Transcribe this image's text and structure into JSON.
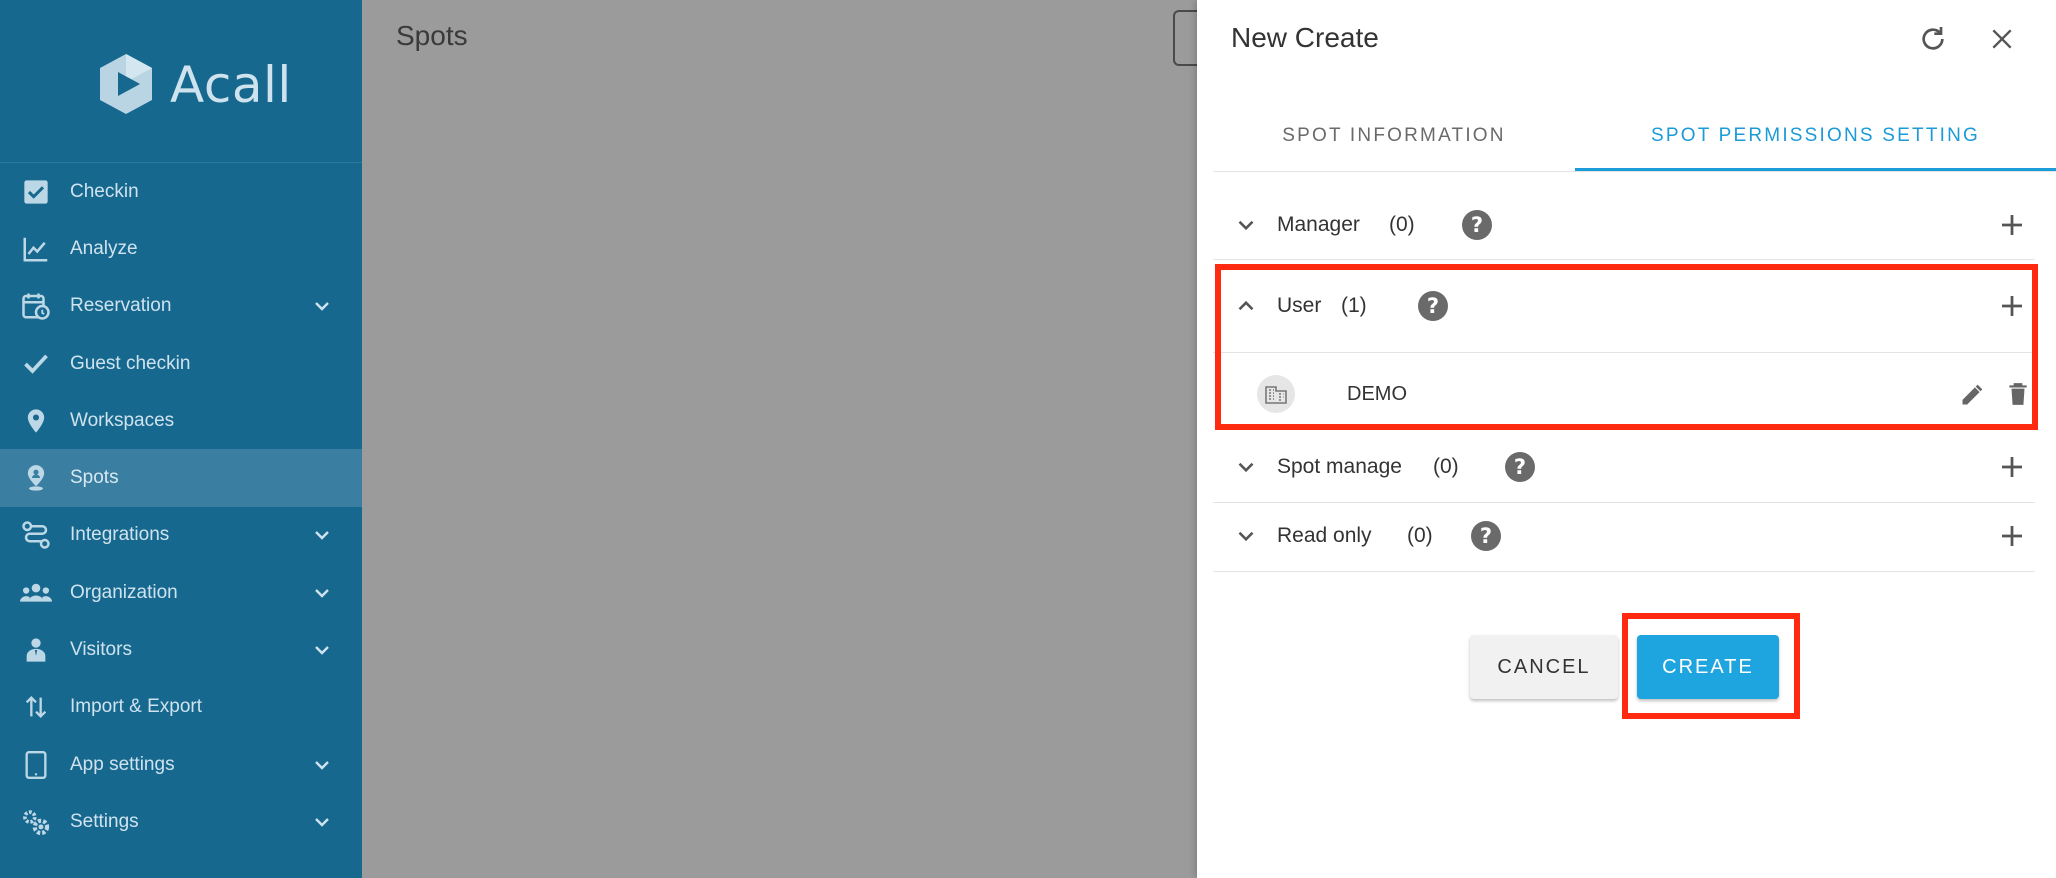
{
  "app": {
    "logo_text": "Acall"
  },
  "sidebar": {
    "items": [
      {
        "label": "Checkin",
        "icon": "checkbox-icon",
        "has_chevron": false
      },
      {
        "label": "Analyze",
        "icon": "chart-line-icon",
        "has_chevron": false
      },
      {
        "label": "Reservation",
        "icon": "calendar-clock-icon",
        "has_chevron": true
      },
      {
        "label": "Guest checkin",
        "icon": "check-icon",
        "has_chevron": false
      },
      {
        "label": "Workspaces",
        "icon": "map-pin-icon",
        "has_chevron": false
      },
      {
        "label": "Spots",
        "icon": "person-pin-icon",
        "has_chevron": false,
        "active": true
      },
      {
        "label": "Integrations",
        "icon": "integrations-icon",
        "has_chevron": true
      },
      {
        "label": "Organization",
        "icon": "group-icon",
        "has_chevron": true
      },
      {
        "label": "Visitors",
        "icon": "visitor-icon",
        "has_chevron": true
      },
      {
        "label": "Import & Export",
        "icon": "import-export-icon",
        "has_chevron": false
      },
      {
        "label": "App settings",
        "icon": "tablet-icon",
        "has_chevron": true
      },
      {
        "label": "Settings",
        "icon": "gears-icon",
        "has_chevron": true
      }
    ]
  },
  "main": {
    "title": "Spots"
  },
  "drawer": {
    "title": "New Create",
    "tabs": [
      {
        "label": "SPOT INFORMATION",
        "active": false
      },
      {
        "label": "SPOT PERMISSIONS SETTING",
        "active": true
      }
    ],
    "sections": [
      {
        "label": "Manager",
        "count": "(0)",
        "expanded": false
      },
      {
        "label": "User",
        "count": "(1)",
        "expanded": true
      },
      {
        "label": "Spot manage",
        "count": "(0)",
        "expanded": false
      },
      {
        "label": "Read only",
        "count": "(0)",
        "expanded": false
      }
    ],
    "user_members": [
      {
        "name": "DEMO",
        "icon": "building-icon"
      }
    ],
    "help_glyph": "?",
    "cancel_label": "CANCEL",
    "create_label": "CREATE"
  },
  "colors": {
    "sidebar_bg": "#17688f",
    "sidebar_active": "#3a7fa2",
    "accent": "#1b9bd7",
    "create_button": "#1ea5e0",
    "highlight": "#ff2a0f",
    "overlay": "#9b9b9b"
  }
}
